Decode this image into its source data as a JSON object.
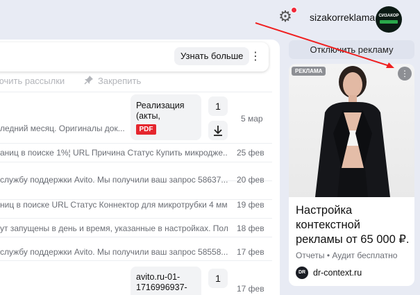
{
  "header": {
    "username": "sizakorreklama",
    "avatar_text": "СИЗАКОР"
  },
  "mail": {
    "learn_more_label": "Узнать больше",
    "toolbar": {
      "disable_mailings_label": "ючить рассылки",
      "pin_label": "Закрепить"
    },
    "rows": [
      {
        "snippet": "ледний месяц. Оригиналы док...",
        "date": "5 мар"
      },
      {
        "snippet": "аниц в поиске 1%¦ URL Причина Статус Купить микродже...",
        "date": "25 фев"
      },
      {
        "snippet": "службу поддержки Avito. Мы получили ваш запрос 58637...",
        "date": "20 фев"
      },
      {
        "snippet": "ниц в поиске URL Статус Коннектор для микротрубки 4 мм...",
        "date": "19 фев"
      },
      {
        "snippet": "ут запущены в день и время, указанные в настройках. Пол...",
        "date": "18 фев"
      },
      {
        "snippet": "службу поддержки Avito. Мы получили ваш запрос 58558...",
        "date": "17 фев"
      },
      {
        "snippet": "",
        "date": "17 фев"
      }
    ],
    "attachment1": {
      "line1": "Реализация",
      "line2": "(акты,",
      "type": "PDF",
      "count": "1"
    },
    "attachment2": {
      "line1": "avito.ru-01-",
      "line2": "1716996937-",
      "count": "1"
    }
  },
  "ads": {
    "disable_label": "Отключить рекламу",
    "badge": "РЕКЛАМА",
    "title": "Настройка контекстной рекламы от 65 000 ₽.",
    "subtitle": "Отчеты • Аудит бесплатно",
    "logo_text": "DR",
    "domain": "dr-context.ru"
  },
  "colors": {
    "accent_red": "#f0293a",
    "pdf_red": "#e5262e",
    "background": "#e8ebf4"
  }
}
